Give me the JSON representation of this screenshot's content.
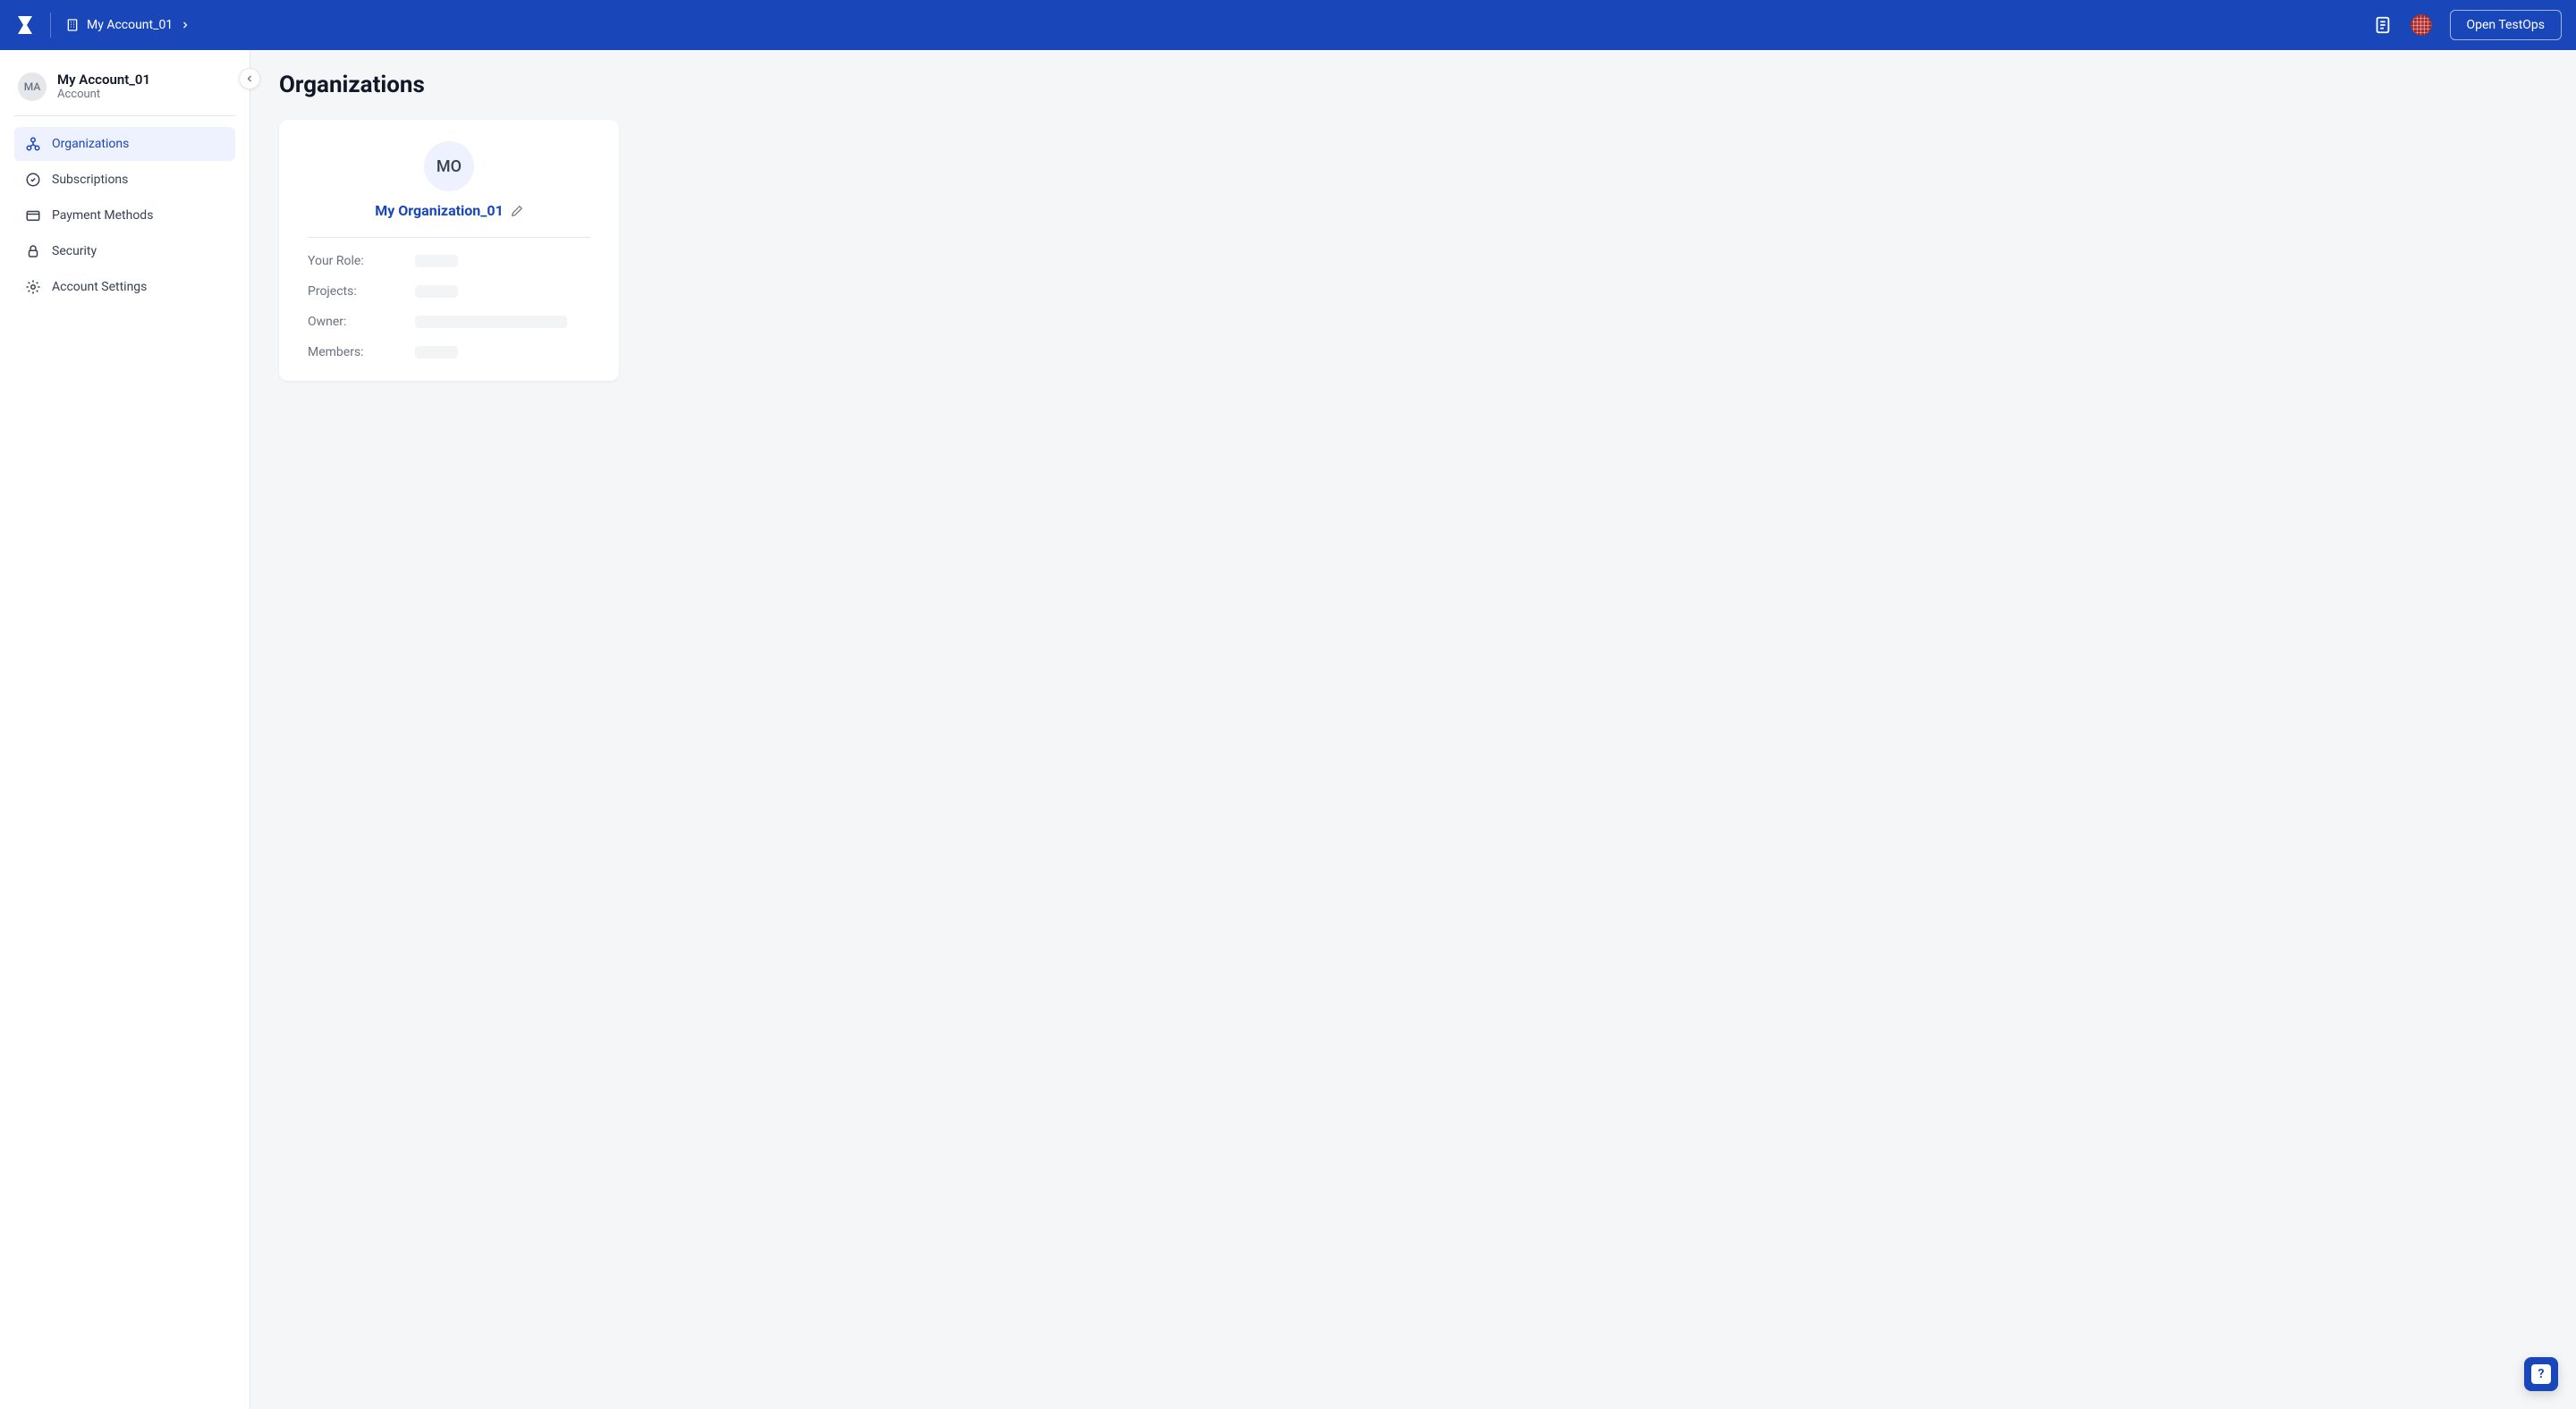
{
  "header": {
    "breadcrumb": "My Account_01",
    "open_testops_label": "Open TestOps"
  },
  "sidebar": {
    "account": {
      "avatar_initials": "MA",
      "name": "My Account_01",
      "type": "Account"
    },
    "items": [
      {
        "label": "Organizations",
        "icon": "organizations-icon",
        "active": true
      },
      {
        "label": "Subscriptions",
        "icon": "subscriptions-icon",
        "active": false
      },
      {
        "label": "Payment Methods",
        "icon": "payment-icon",
        "active": false
      },
      {
        "label": "Security",
        "icon": "security-icon",
        "active": false
      },
      {
        "label": "Account Settings",
        "icon": "settings-icon",
        "active": false
      }
    ]
  },
  "page": {
    "title": "Organizations"
  },
  "org_card": {
    "avatar_initials": "MO",
    "name": "My Organization_01",
    "details": {
      "role_label": "Your Role:",
      "projects_label": "Projects:",
      "owner_label": "Owner:",
      "members_label": "Members:"
    }
  }
}
